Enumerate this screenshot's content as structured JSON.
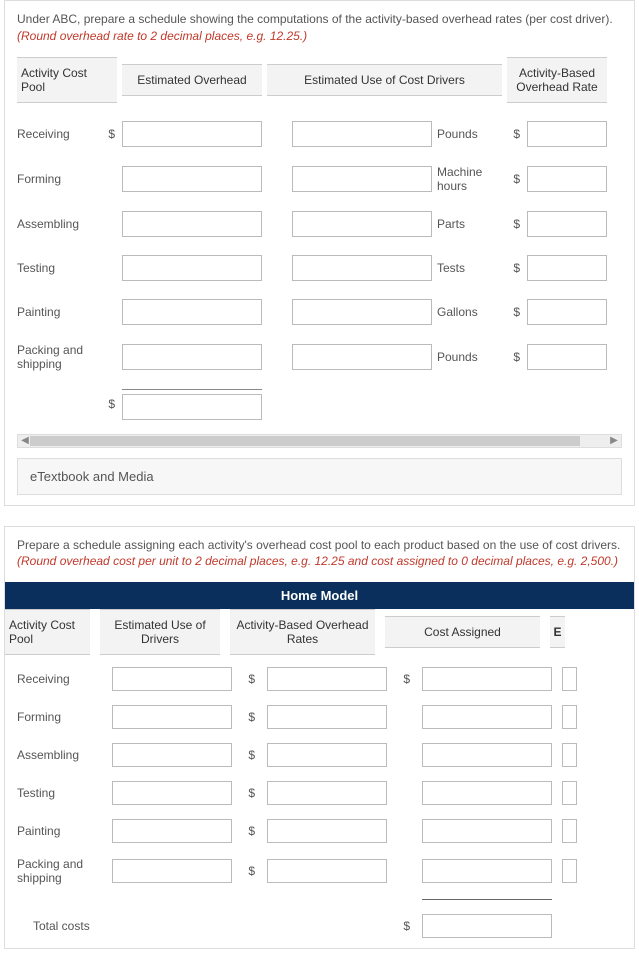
{
  "section1": {
    "instruction_plain": "Under ABC, prepare a schedule showing the computations of the activity-based overhead rates (per cost driver). ",
    "instruction_red": "(Round overhead rate to 2 decimal places, e.g. 12.25.)",
    "headers": {
      "pool": "Activity Cost Pool",
      "overhead": "Estimated Overhead",
      "usage": "Estimated Use of Cost Drivers",
      "rate": "Activity-Based Overhead Rate"
    },
    "rows": [
      {
        "label": "Receiving",
        "dollar_oh": "$",
        "unit": "Pounds",
        "dollar_rate": "$"
      },
      {
        "label": "Forming",
        "dollar_oh": "",
        "unit": "Machine hours",
        "dollar_rate": "$"
      },
      {
        "label": "Assembling",
        "dollar_oh": "",
        "unit": "Parts",
        "dollar_rate": "$"
      },
      {
        "label": "Testing",
        "dollar_oh": "",
        "unit": "Tests",
        "dollar_rate": "$"
      },
      {
        "label": "Painting",
        "dollar_oh": "",
        "unit": "Gallons",
        "dollar_rate": "$"
      },
      {
        "label": "Packing and shipping",
        "dollar_oh": "",
        "unit": "Pounds",
        "dollar_rate": "$"
      }
    ],
    "total_dollar": "$",
    "accordion": "eTextbook and Media"
  },
  "section2": {
    "instruction_plain": "Prepare a schedule assigning each activity's overhead cost pool to each product based on the use of cost drivers. ",
    "instruction_red": "(Round overhead cost per unit to 2 decimal places, e.g. 12.25 and cost assigned to 0 decimal places, e.g. 2,500.)",
    "group_header": "Home Model",
    "headers": {
      "pool": "Activity Cost Pool",
      "drivers": "Estimated Use of Drivers",
      "rates": "Activity-Based Overhead Rates",
      "assigned": "Cost Assigned",
      "trunc": "E"
    },
    "rows": [
      {
        "label": "Receiving",
        "dollar_rate": "$",
        "dollar_assigned": "$"
      },
      {
        "label": "Forming",
        "dollar_rate": "$",
        "dollar_assigned": ""
      },
      {
        "label": "Assembling",
        "dollar_rate": "$",
        "dollar_assigned": ""
      },
      {
        "label": "Testing",
        "dollar_rate": "$",
        "dollar_assigned": ""
      },
      {
        "label": "Painting",
        "dollar_rate": "$",
        "dollar_assigned": ""
      },
      {
        "label": "Packing and shipping",
        "dollar_rate": "$",
        "dollar_assigned": ""
      }
    ],
    "total_label": "Total costs",
    "total_dollar": "$"
  }
}
